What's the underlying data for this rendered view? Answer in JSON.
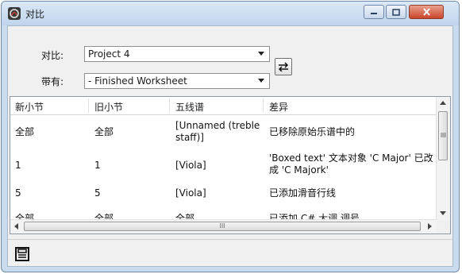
{
  "window": {
    "title": "对比",
    "app_icon": "app-logo-icon",
    "controls": [
      "minimize-icon",
      "maximize-icon",
      "close-icon"
    ]
  },
  "compare": {
    "compare_label": "对比:",
    "compare_value": "Project 4",
    "with_label": "带有:",
    "with_value": "- Finished Worksheet",
    "swap_icon": "swap-arrows-icon"
  },
  "table": {
    "columns": [
      "新小节",
      "旧小节",
      "五线谱",
      "差异"
    ],
    "rows": [
      {
        "new_bar": "全部",
        "old_bar": "全部",
        "staff": "[Unnamed (treble staff)]",
        "difference": "已移除原始乐谱中的"
      },
      {
        "new_bar": "1",
        "old_bar": "1",
        "staff": "[Viola]",
        "difference": "'Boxed text' 文本对象 'C Major' 已改成 'C Majork'"
      },
      {
        "new_bar": "5",
        "old_bar": "5",
        "staff": "[Viola]",
        "difference": "已添加滑音行线"
      },
      {
        "new_bar": "全部",
        "old_bar": "全部",
        "staff": "全部",
        "difference": "已添加 C# 大调 调号"
      }
    ],
    "hscroll_grip": "III"
  },
  "footer": {
    "save_icon": "save-icon"
  }
}
